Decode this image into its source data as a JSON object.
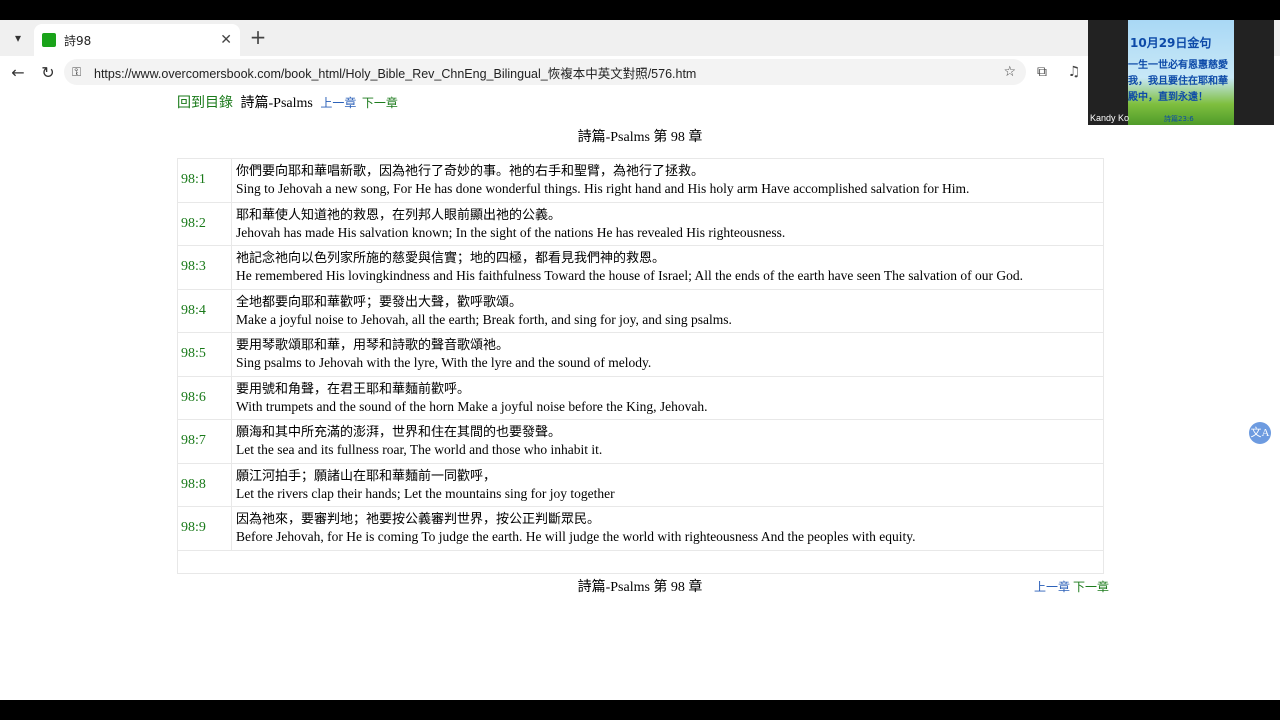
{
  "browser": {
    "tab_title": "詩98",
    "url": "https://www.overcomersbook.com/book_html/Holy_Bible_Rev_ChnEng_Bilingual_恢複本中英文對照/576.htm",
    "icons": {
      "tab_menu": "chevron-down-icon",
      "favicon": "green-square-icon",
      "close": "close-icon",
      "new_tab": "plus-icon",
      "back": "back-arrow-icon",
      "reload": "reload-icon",
      "site_info": "site-info-icon",
      "favorite": "star-icon",
      "extensions": "extensions-icon",
      "media": "media-control-icon"
    }
  },
  "video_overlay": {
    "name": "Kandy Ko",
    "slide_title": "10月29日金句",
    "slide_line1": "一生一世必有恩惠慈愛",
    "slide_line2": "我，我且要住在耶和華",
    "slide_line3": "殿中，直到永遠！",
    "slide_ref": "詩篇23:6"
  },
  "page": {
    "toc_link": "回到目錄",
    "book_name": "詩篇-Psalms",
    "prev_chapter": "上一章",
    "next_chapter": "下一章",
    "heading": "詩篇-Psalms 第 98 章",
    "verses": [
      {
        "num": "98:1",
        "zh": "你們要向耶和華唱新歌，因為祂行了奇妙的事。祂的右手和聖臂，為祂行了拯救。",
        "en": "Sing to Jehovah a new song, For He has done wonderful things. His right hand and His holy arm Have accomplished salvation for Him."
      },
      {
        "num": "98:2",
        "zh": "耶和華使人知道祂的救恩，在列邦人眼前顯出祂的公義。",
        "en": "Jehovah has made His salvation known; In the sight of the nations He has revealed His righteousness."
      },
      {
        "num": "98:3",
        "zh": "祂記念祂向以色列家所施的慈愛與信實；地的四極，都看見我們神的救恩。",
        "en": "He remembered His lovingkindness and His faithfulness Toward the house of Israel; All the ends of the earth have seen The salvation of our God."
      },
      {
        "num": "98:4",
        "zh": "全地都要向耶和華歡呼；要發出大聲，歡呼歌頌。",
        "en": "Make a joyful noise to Jehovah, all the earth; Break forth, and sing for joy, and sing psalms."
      },
      {
        "num": "98:5",
        "zh": "要用琴歌頌耶和華，用琴和詩歌的聲音歌頌祂。",
        "en": "Sing psalms to Jehovah with the lyre, With the lyre and the sound of melody."
      },
      {
        "num": "98:6",
        "zh": "要用號和角聲，在君王耶和華麵前歡呼。",
        "en": "With trumpets and the sound of the horn Make a joyful noise before the King, Jehovah."
      },
      {
        "num": "98:7",
        "zh": "願海和其中所充滿的澎湃，世界和住在其間的也要發聲。",
        "en": "Let the sea and its fullness roar, The world and those who inhabit it."
      },
      {
        "num": "98:8",
        "zh": "願江河拍手；願諸山在耶和華麵前一同歡呼，",
        "en": "Let the rivers clap their hands; Let the mountains sing for joy together"
      },
      {
        "num": "98:9",
        "zh": "因為祂來，要審判地；祂要按公義審判世界，按公正判斷眾民。",
        "en": "Before Jehovah, for He is coming To judge the earth. He will judge the world with righteousness And the peoples with equity."
      }
    ],
    "footer_heading": "詩篇-Psalms 第 98 章",
    "footer_prev": "上一章",
    "footer_next": "下一章",
    "translate_icon": "translate-icon"
  }
}
